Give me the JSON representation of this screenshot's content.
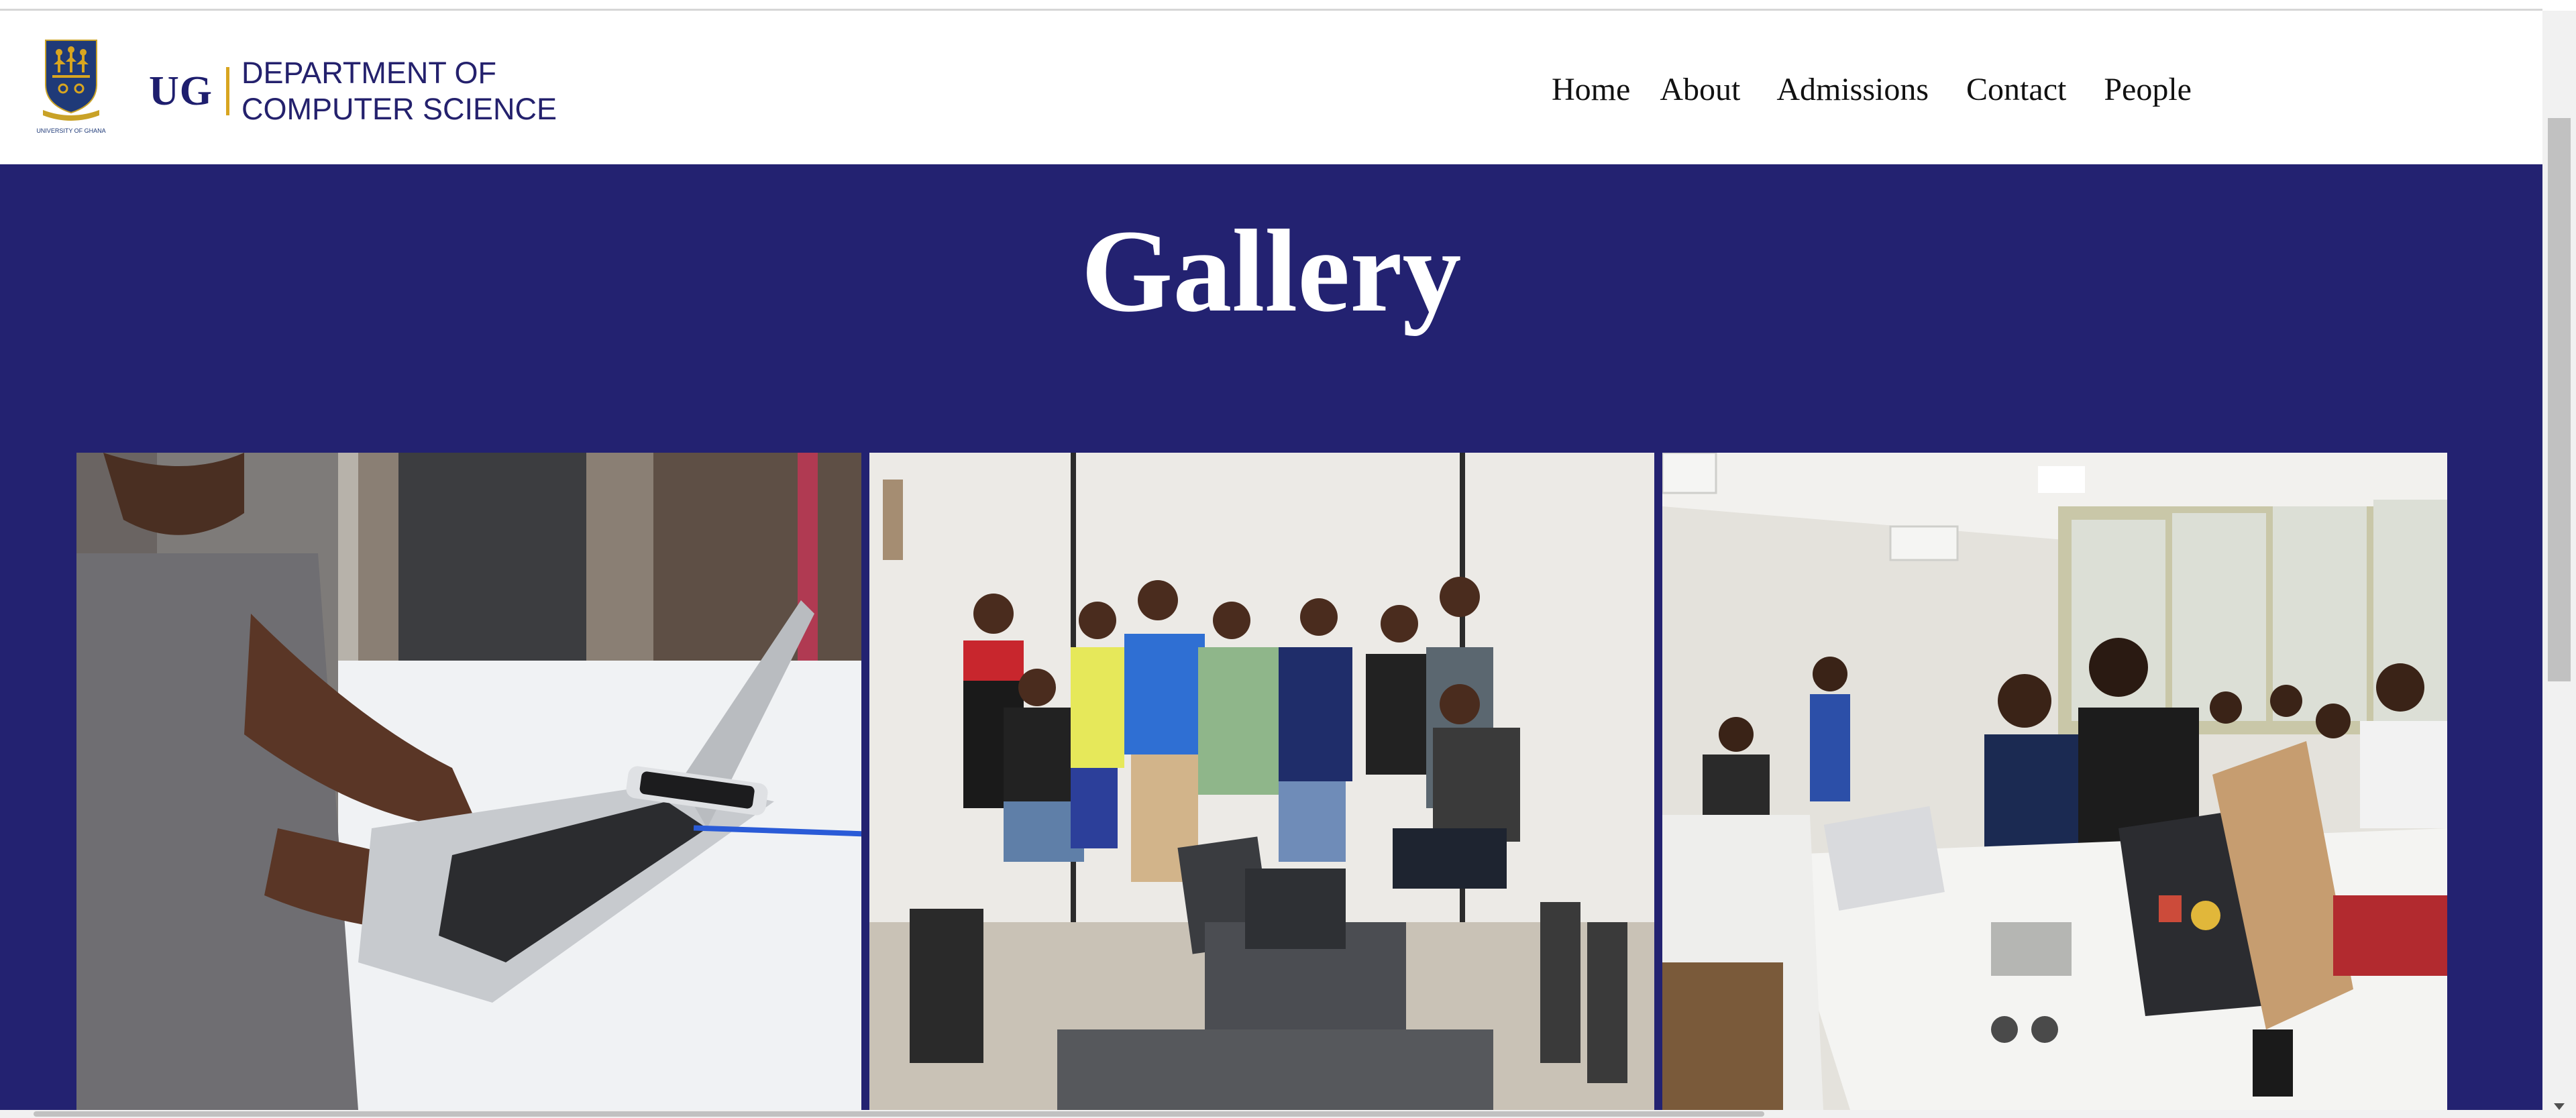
{
  "header": {
    "crest_caption": "UNIVERSITY OF GHANA",
    "logo_mark": "UG",
    "department_line1": "DEPARTMENT OF",
    "department_line2": "COMPUTER SCIENCE"
  },
  "nav": {
    "items": [
      {
        "label": "Home"
      },
      {
        "label": "About"
      },
      {
        "label": "Admissions"
      },
      {
        "label": "Contact"
      },
      {
        "label": "People"
      }
    ]
  },
  "hero": {
    "title": "Gallery"
  },
  "gallery": {
    "images": [
      {
        "label": "student-typing-on-laptop"
      },
      {
        "label": "group-of-students-with-lab-equipment"
      },
      {
        "label": "students-in-computer-lab"
      }
    ]
  },
  "colors": {
    "brand_navy": "#232271",
    "accent_gold": "#d8a520",
    "text_dark": "#111111"
  }
}
